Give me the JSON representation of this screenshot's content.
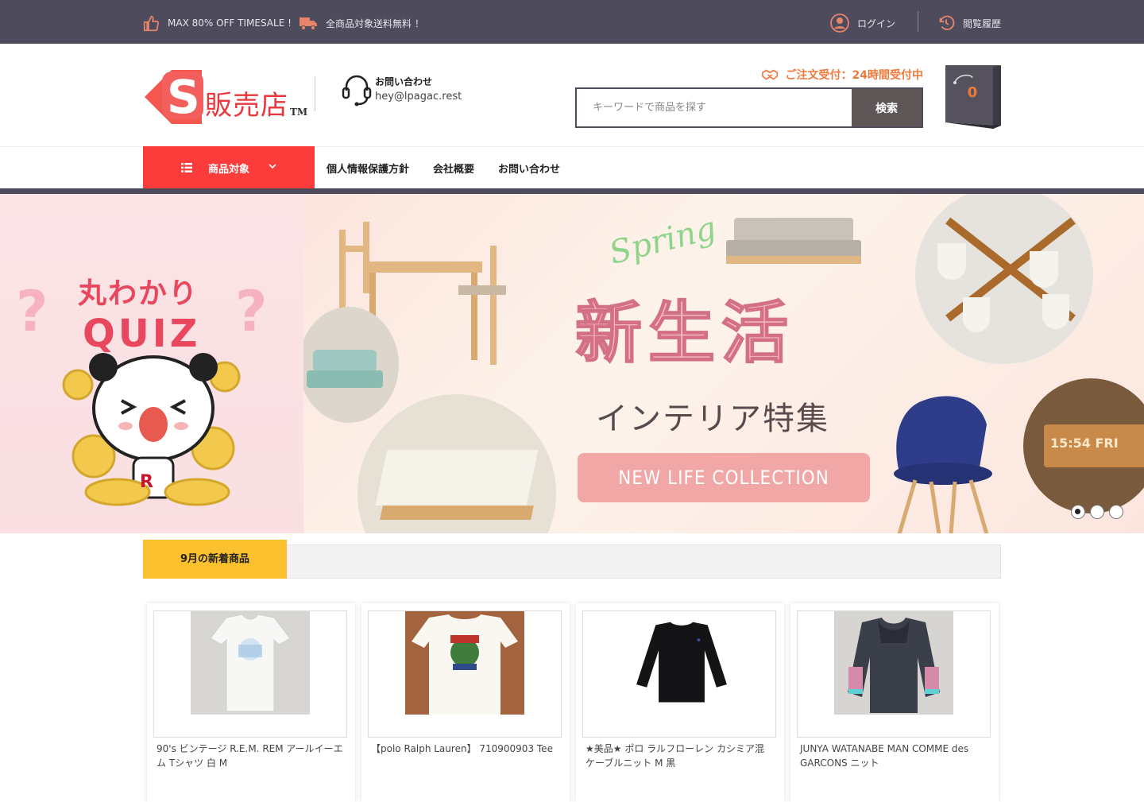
{
  "topbar": {
    "promo1": "MAX 80% OFF TIMESALE !",
    "promo2": "全商品対象送料無料 ！",
    "login": "ログイン",
    "history": "閲覧履歴"
  },
  "header": {
    "logo_text": "販売店",
    "logo_tm": "TM",
    "contact_title": "お問い合わせ",
    "contact_email": "hey@lpagac.rest",
    "order_note": "ご注文受付：24時間受付中",
    "search_placeholder": "キーワードで商品を探す",
    "search_button": "検索",
    "cart_count": "0"
  },
  "nav": {
    "category_button": "商品対象",
    "links": [
      "個人情報保護方針",
      "会社概要",
      "お問い合わせ"
    ]
  },
  "banner": {
    "left_title": "丸わかり",
    "left_sub": "QUIZ",
    "left_badge": "R",
    "right_script": "Spring",
    "right_main": "新生活",
    "right_sub": "インテリア特集",
    "right_pill": "NEW LIFE COLLECTION",
    "clock_text": "15:54 FRI",
    "slides_total": 3,
    "active_slide": 1
  },
  "section": {
    "title": "9月の新着商品"
  },
  "products": [
    {
      "name": "90's ビンテージ R.E.M. REM アールイーエム Tシャツ 白 M"
    },
    {
      "name": "【polo Ralph Lauren】 710900903 Tee"
    },
    {
      "name": "★美品★ ポロ ラルフローレン カシミア混 ケーブルニット M 黒"
    },
    {
      "name": "JUNYA WATANABE MAN COMME des GARCONS ニット"
    }
  ],
  "colors": {
    "topbar": "#4e4c5c",
    "accent_red": "#fc3b3b",
    "accent_orange": "#f07a3c",
    "section_yellow": "#fbc02d"
  }
}
